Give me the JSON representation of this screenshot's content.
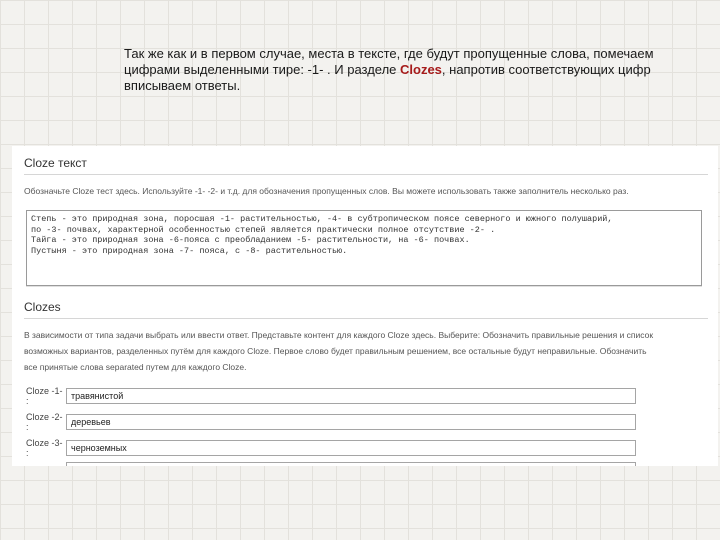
{
  "slide": {
    "text_part1": "Так же как и в первом случае, места в тексте,  где будут пропущенные слова, помечаем цифрами выделенными тире: -1- . И разделе ",
    "text_highlight": "Clozes",
    "text_part2": ", напротив соответствующих цифр вписываем ответы."
  },
  "form": {
    "cloze_text_section": {
      "title": "Cloze текст",
      "hint": "Обозначьте Cloze тест здесь. Используйте -1- -2- и т.д. для обозначения пропущенных слов. Вы можете использовать также заполнитель несколько раз."
    },
    "cloze_text_lines": [
      "Степь - это природная зона, поросшая -1- растительностью, -4- в субтропическом поясе северного и южного полушарий,",
      "по -3- почвах, характерной особенностью степей является практически полное отсутствие -2- .",
      "Тайга - это природная зона -6-пояса с преобладанием -5- растительности, на -6- почвах.",
      "Пустыня - это природная зона -7- пояса, с -8- растительностью."
    ],
    "clozes_section": {
      "title": "Clozes",
      "hint_lines": [
        "В зависимости от типа задачи выбрать или ввести ответ. Представьте контент для каждого Cloze здесь. Выберите: Обозначить правильные решения и список",
        "возможных вариантов, разделенных путём для каждого Cloze. Первое слово будет правильным решением, все остальные будут неправильные. Обозначить",
        "все принятые слова separated путем для каждого Cloze."
      ]
    },
    "cloze_rows": [
      {
        "label": "Cloze -1- :",
        "value": "травянистой"
      },
      {
        "label": "Cloze -2- :",
        "value": "деревьев"
      },
      {
        "label": "Cloze -3- :",
        "value": "черноземных"
      },
      {
        "label": "",
        "value": ""
      }
    ]
  }
}
